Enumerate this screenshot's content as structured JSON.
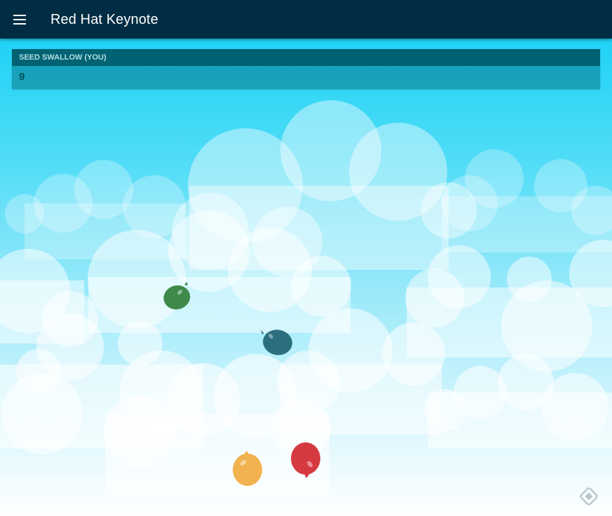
{
  "app": {
    "title": "Red Hat Keynote",
    "menu_icon": "hamburger-menu-icon"
  },
  "scoreboard": {
    "player_label": "SEED SWALLOW (YOU)",
    "score": "9"
  },
  "balloons": [
    {
      "color": "green",
      "hex": "#3f8a4a"
    },
    {
      "color": "teal",
      "hex": "#2b6f7e"
    },
    {
      "color": "yellow",
      "hex": "#f2b24f"
    },
    {
      "color": "red",
      "hex": "#d63a41"
    }
  ],
  "colors": {
    "app_bar": "#012d44",
    "score_header": "#006272",
    "sky_top": "#1fd2f5",
    "sky_bottom": "#ffffff"
  },
  "footer": {
    "logo_icon": "brand-logo-icon"
  }
}
